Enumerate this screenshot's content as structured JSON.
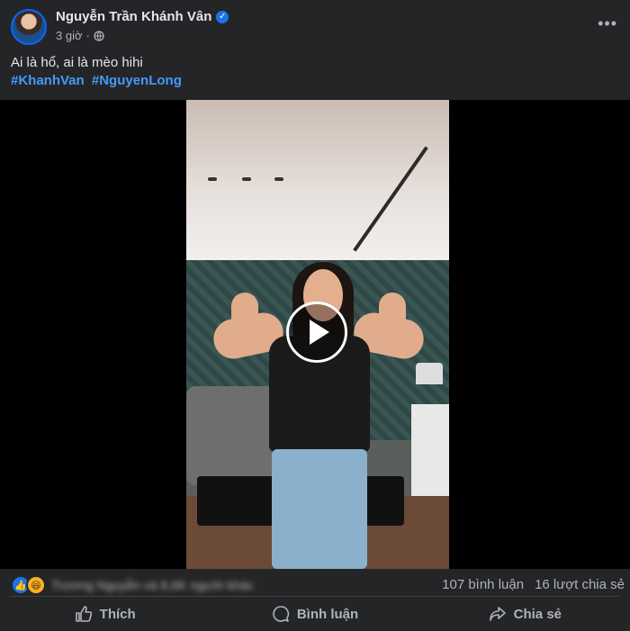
{
  "post": {
    "author_name": "Nguyễn Trần Khánh Vân",
    "verified_mark": "✓",
    "time_ago": "3 giờ",
    "separator": "·",
    "more_label": "•••",
    "caption": "Ai là hổ, ai là mèo hihi",
    "hashtags": [
      "#KhanhVan",
      "#NguyenLong"
    ]
  },
  "video": {
    "play_icon": "play-icon"
  },
  "stats": {
    "reactions": [
      {
        "type": "like",
        "glyph": "👍"
      },
      {
        "type": "haha",
        "glyph": "😆"
      }
    ],
    "reactor_text": "Trương Nguyễn và 8,6K người khác",
    "comments": "107 bình luận",
    "shares": "16 lượt chia sẻ"
  },
  "actions": {
    "like_label": "Thích",
    "comment_label": "Bình luận",
    "share_label": "Chia sẻ"
  },
  "colors": {
    "background": "#242526",
    "hashtag": "#4599ff",
    "verified": "#1b74e4"
  }
}
